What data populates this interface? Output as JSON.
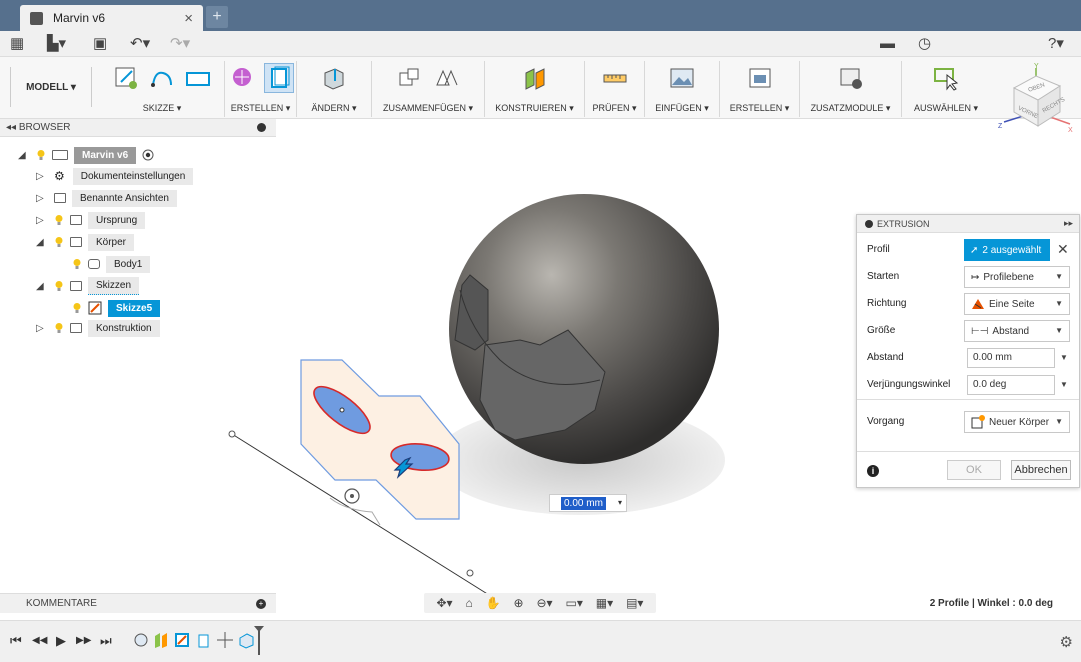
{
  "window": {
    "tab_title": "Marvin v6",
    "close_glyph": "×",
    "newtab_glyph": "+"
  },
  "quickbar": {
    "grid_glyph": "▦",
    "file_glyph": "▙▾",
    "save_glyph": "▣",
    "undo_glyph": "↶▾",
    "redo_glyph": "↷▾",
    "chat_glyph": "▬",
    "history_glyph": "◷",
    "help_glyph": "?▾"
  },
  "ribbon": {
    "mode_label": "MODELL ▾",
    "groups": [
      {
        "label": "SKIZZE ▾"
      },
      {
        "label": "ERSTELLEN ▾"
      },
      {
        "label": "ÄNDERN ▾"
      },
      {
        "label": "ZUSAMMENFÜGEN ▾"
      },
      {
        "label": "KONSTRUIEREN ▾"
      },
      {
        "label": "PRÜFEN ▾"
      },
      {
        "label": "EINFÜGEN ▾"
      },
      {
        "label": "ERSTELLEN ▾"
      },
      {
        "label": "ZUSATZMODULE ▾"
      },
      {
        "label": "AUSWÄHLEN ▾"
      }
    ]
  },
  "viewcube": {
    "front": "VORNE",
    "right": "RECHTS",
    "top": "OBEN",
    "axis_x": "X",
    "axis_y": "Y",
    "axis_z": "Z"
  },
  "browser": {
    "title": "◂◂ BROWSER",
    "root": "Marvin v6",
    "items": [
      {
        "label": "Dokumenteinstellungen"
      },
      {
        "label": "Benannte Ansichten"
      },
      {
        "label": "Ursprung"
      },
      {
        "label": "Körper"
      },
      {
        "label": "Body1"
      },
      {
        "label": "Skizzen"
      },
      {
        "label": "Skizze5"
      },
      {
        "label": "Konstruktion"
      }
    ]
  },
  "extrusion": {
    "title": "EXTRUSION",
    "collapse_glyph": "▸▸",
    "profil_label": "Profil",
    "profil_value": "2 ausgewählt",
    "starten_label": "Starten",
    "starten_value": "Profilebene",
    "richtung_label": "Richtung",
    "richtung_value": "Eine Seite",
    "groesse_label": "Größe",
    "groesse_value": "Abstand",
    "abstand_label": "Abstand",
    "abstand_value": "0.00 mm",
    "winkel_label": "Verjüngungswinkel",
    "winkel_value": "0.0 deg",
    "vorgang_label": "Vorgang",
    "vorgang_value": "Neuer Körper",
    "ok_label": "OK",
    "cancel_label": "Abbrechen",
    "info_glyph": "i"
  },
  "canvas": {
    "distance_value": "0.00 mm"
  },
  "bottom": {
    "comments_label": "KOMMENTARE",
    "status": "2 Profile | Winkel : 0.0 deg",
    "nav_glyphs": [
      "✥▾",
      "⌂",
      "✋",
      "⊕",
      "⊖▾",
      "▭▾",
      "▦▾",
      "▤▾"
    ]
  },
  "timeline": {
    "controls": [
      "⏮",
      "◀◀",
      "▶",
      "▶▶",
      "⏭"
    ],
    "gear_glyph": "⚙"
  },
  "colors": {
    "accent": "#0696d7",
    "titlebar": "#56708d",
    "sketch_fill": "#fdf0e3",
    "profile_blue": "#6f9be0",
    "profile_red": "#d62a2a"
  }
}
